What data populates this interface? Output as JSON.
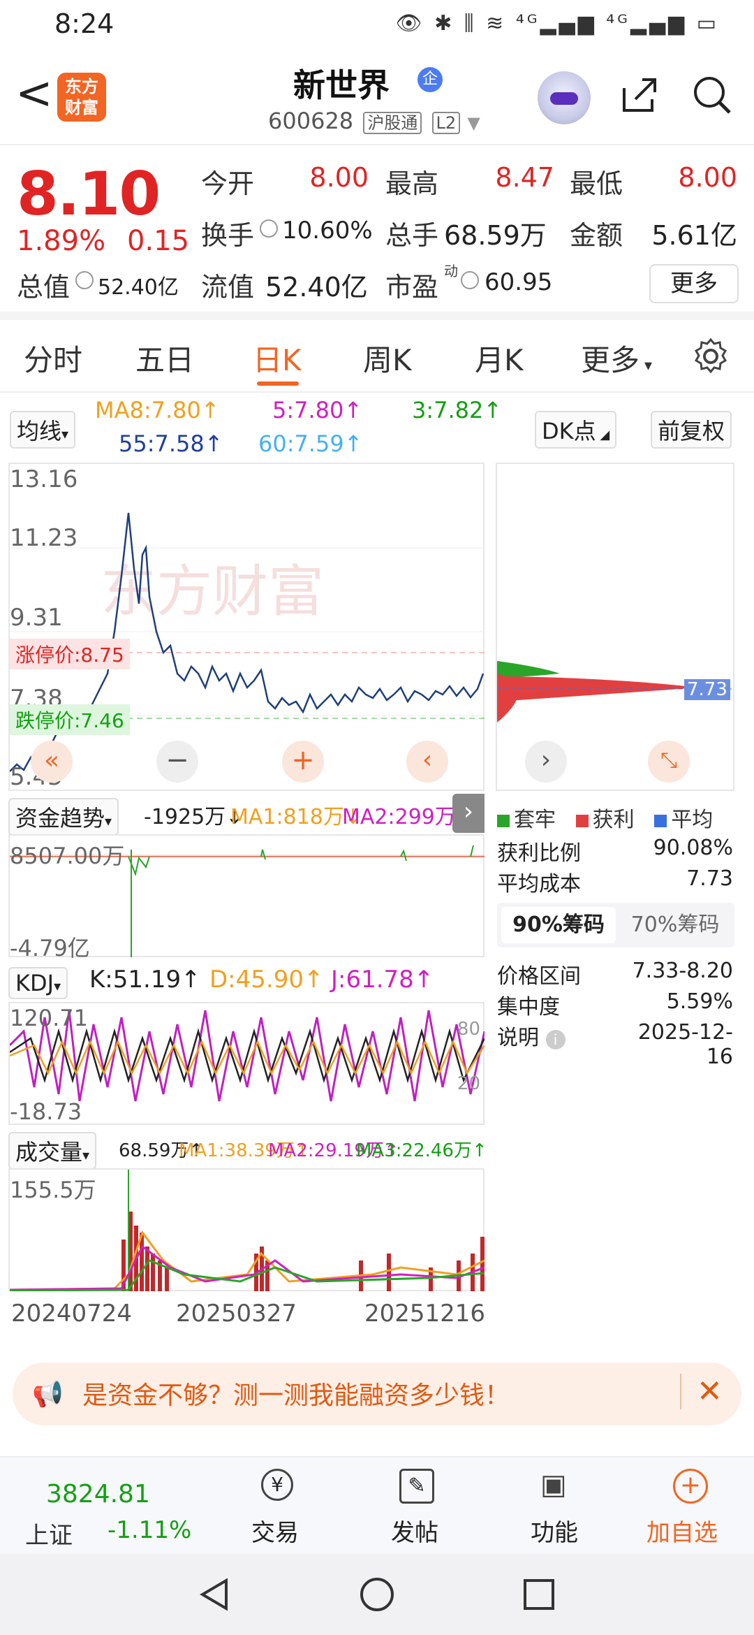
{
  "status": {
    "time": "8:24",
    "icons": "👁 ✱ ⫼ ≋ ⁴ᴳ▂▄▆ ⁴ᴳ▂▄▆ ▭"
  },
  "header": {
    "back": "<",
    "logo": "东方\n财富",
    "name": "新世界",
    "verified": "企",
    "code": "600628",
    "tag1": "沪股通",
    "tag2": "L2"
  },
  "quote": {
    "price": "8.10",
    "pct": "1.89%",
    "change": "0.15",
    "open_l": "今开",
    "open": "8.00",
    "high_l": "最高",
    "high": "8.47",
    "low_l": "最低",
    "low": "8.00",
    "turn_l": "换手",
    "turn": "10.60%",
    "vol_l": "总手",
    "vol": "68.59万",
    "amt_l": "金额",
    "amt": "5.61亿",
    "mcap_l": "总值",
    "mcap": "52.40亿",
    "float_l": "流值",
    "float": "52.40亿",
    "pe_l": "市盈",
    "pe_sup": "动",
    "pe": "60.95",
    "more": "更多"
  },
  "tabs": [
    "分时",
    "五日",
    "日K",
    "周K",
    "月K",
    "更多"
  ],
  "ma": {
    "selector": "均线",
    "ma8": "MA8:7.80↑",
    "ma5": "5:7.80↑",
    "ma3": "3:7.82↑",
    "ma55": "55:7.58↑",
    "ma60": "60:7.59↑",
    "dk": "DK点",
    "fq": "前复权"
  },
  "kline": {
    "y1": "13.16",
    "y2": "11.23",
    "y3": "9.31",
    "y4": "7.38",
    "y5": "5.45",
    "up_limit": "涨停价:8.75",
    "down_limit": "跌停价:7.46",
    "watermark": "东方财富",
    "chip_price": "7.73"
  },
  "fund": {
    "selector": "资金趋势",
    "v": "-1925万↓",
    "ma1": "MA1:818万↓",
    "ma2": "MA2:299万↓",
    "top": "8507.00万",
    "bottom": "-4.79亿"
  },
  "kdj": {
    "selector": "KDJ",
    "k": "K:51.19↑",
    "d": "D:45.90↑",
    "j": "J:61.78↑",
    "top": "120.71",
    "bottom": "-18.73",
    "r80": "80",
    "r20": "20"
  },
  "volume": {
    "selector": "成交量",
    "v": "68.59万↑",
    "ma1": "MA1:38.39万↑",
    "ma2": "MA2:29.19万↑",
    "ma3": "MA3:22.46万↑",
    "top": "155.5万",
    "d1": "20240724",
    "d2": "20250327",
    "d3": "20251216"
  },
  "chips": {
    "legend1": "套牢",
    "legend2": "获利",
    "legend3": "平均",
    "profit_l": "获利比例",
    "profit": "90.08%",
    "cost_l": "平均成本",
    "cost": "7.73",
    "tab90": "90%筹码",
    "tab70": "70%筹码",
    "range_l": "价格区间",
    "range": "7.33-8.20",
    "conc_l": "集中度",
    "conc": "5.59%",
    "note_l": "说明",
    "note": "2025-12-16"
  },
  "banner": {
    "text": "是资金不够？测一测我能融资多少钱！"
  },
  "bottom": {
    "index": "3824.81",
    "index_name": "上证",
    "index_chg": "-1.11%",
    "trade": "交易",
    "post": "发帖",
    "func": "功能",
    "add": "加自选"
  },
  "colors": {
    "up": "#e02424",
    "down": "#13a013",
    "accent": "#f26522",
    "line": "#1f3f7a"
  }
}
